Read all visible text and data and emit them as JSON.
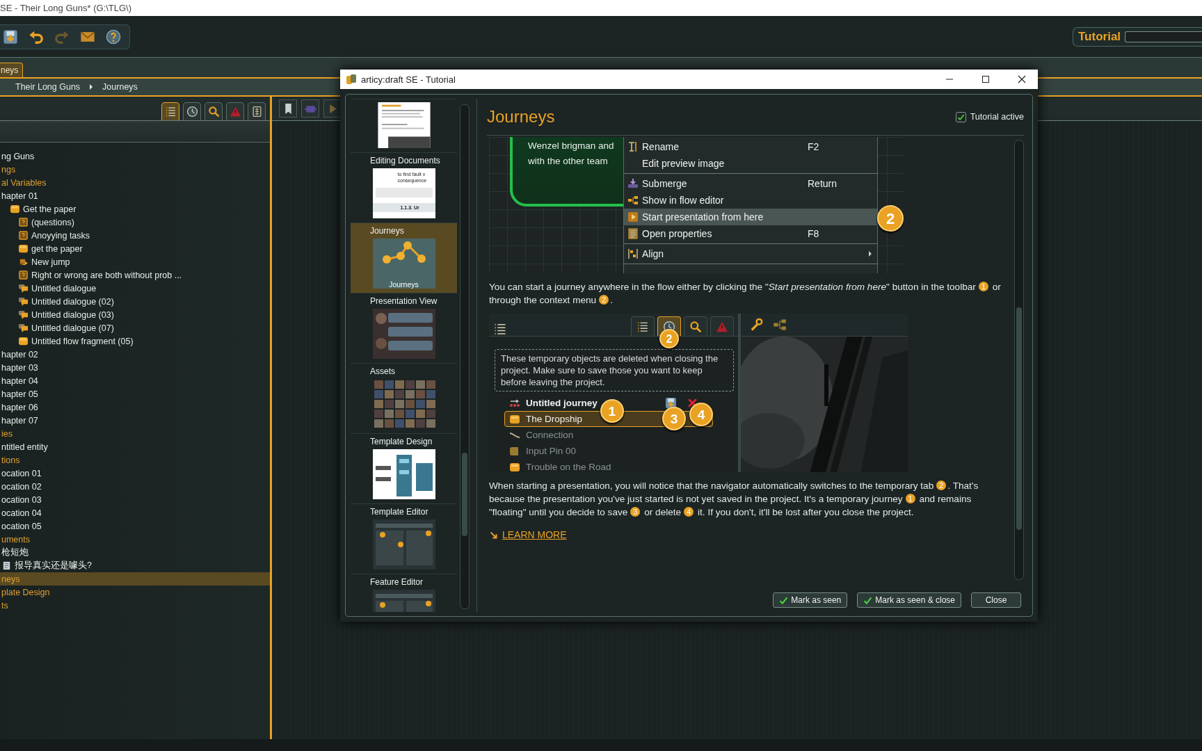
{
  "app": {
    "title": "SE - Their Long Guns* (G:\\TLG\\)",
    "toolbar": [
      {
        "kind": "save",
        "disabled": false
      },
      {
        "kind": "undo",
        "disabled": false
      },
      {
        "kind": "redo",
        "disabled": true
      },
      {
        "kind": "mail",
        "disabled": false
      },
      {
        "kind": "help",
        "disabled": false
      }
    ],
    "tutorial_label": "Tutorial"
  },
  "tabs": [
    {
      "label": "neys",
      "selected": true
    }
  ],
  "breadcrumb": [
    "Their Long Guns",
    "Journeys"
  ],
  "navigator": {
    "tools": [
      {
        "kind": "list",
        "selected": true
      },
      {
        "kind": "clock",
        "selected": false
      },
      {
        "kind": "search",
        "selected": false
      },
      {
        "kind": "warning",
        "selected": false
      },
      {
        "kind": "grid",
        "selected": false
      }
    ],
    "tree": [
      {
        "label": "ng Guns",
        "kind": "entry",
        "selected": false
      },
      {
        "label": "ngs",
        "kind": "folder",
        "selected": false
      },
      {
        "label": "al Variables",
        "kind": "folder",
        "selected": false
      },
      {
        "label": "hapter 01",
        "kind": "entry",
        "selected": false,
        "children": [
          {
            "label": "Get the paper",
            "kind": "fragment",
            "selected": false,
            "children": [
              {
                "label": "(questions)",
                "kind": "question",
                "selected": false
              },
              {
                "label": "Anoyying tasks",
                "kind": "question",
                "selected": false
              },
              {
                "label": "get the paper",
                "kind": "fragment",
                "selected": false
              },
              {
                "label": "New jump",
                "kind": "jump",
                "selected": false
              },
              {
                "label": "Right or wrong are both without prob ...",
                "kind": "question",
                "selected": false
              },
              {
                "label": "Untitled dialogue",
                "kind": "dialogue",
                "selected": false
              },
              {
                "label": "Untitled dialogue (02)",
                "kind": "dialogue",
                "selected": false
              },
              {
                "label": "Untitled dialogue (03)",
                "kind": "dialogue",
                "selected": false
              },
              {
                "label": "Untitled dialogue (07)",
                "kind": "dialogue",
                "selected": false
              },
              {
                "label": "Untitled flow fragment (05)",
                "kind": "fragment",
                "selected": false
              }
            ]
          }
        ]
      },
      {
        "label": "hapter 02",
        "kind": "entry",
        "selected": false
      },
      {
        "label": "hapter 03",
        "kind": "entry",
        "selected": false
      },
      {
        "label": "hapter 04",
        "kind": "entry",
        "selected": false
      },
      {
        "label": "hapter 05",
        "kind": "entry",
        "selected": false
      },
      {
        "label": "hapter 06",
        "kind": "entry",
        "selected": false
      },
      {
        "label": "hapter 07",
        "kind": "entry",
        "selected": false
      },
      {
        "label": "ies",
        "kind": "folder",
        "selected": false
      },
      {
        "label": "ntitled entity",
        "kind": "entry",
        "selected": false
      },
      {
        "label": "tions",
        "kind": "folder",
        "selected": false
      },
      {
        "label": "ocation 01",
        "kind": "entry",
        "selected": false
      },
      {
        "label": "ocation 02",
        "kind": "entry",
        "selected": false
      },
      {
        "label": "ocation 03",
        "kind": "entry",
        "selected": false
      },
      {
        "label": "ocation 04",
        "kind": "entry",
        "selected": false
      },
      {
        "label": "ocation 05",
        "kind": "entry",
        "selected": false
      },
      {
        "label": "uments",
        "kind": "folder",
        "selected": false
      },
      {
        "label": "枪短炮",
        "kind": "entry",
        "selected": false
      },
      {
        "label": "报导真实还是噱头?",
        "kind": "document",
        "selected": false
      },
      {
        "label": "neys",
        "kind": "folder",
        "selected": true
      },
      {
        "label": "plate Design",
        "kind": "folder",
        "selected": false
      },
      {
        "label": "ts",
        "kind": "folder",
        "selected": false
      }
    ]
  },
  "editor_tools": [
    {
      "kind": "page"
    },
    {
      "kind": "node"
    },
    {
      "kind": "play"
    }
  ],
  "dialog": {
    "title": "articy:draft SE - Tutorial",
    "topics": [
      {
        "kind": "document",
        "selected": false
      },
      {
        "label": "Editing Documents",
        "kind": "editor",
        "texts": [
          "to find fault v",
          "consequence",
          "1.1.3. Ur"
        ],
        "selected": false
      },
      {
        "label": "Journeys",
        "kind": "journeys",
        "caption": "Journeys",
        "selected": true
      },
      {
        "label": "Presentation View",
        "kind": "presentation",
        "selected": false
      },
      {
        "label": "Assets",
        "kind": "assets",
        "selected": false
      },
      {
        "label": "Template Design",
        "kind": "template",
        "selected": false
      },
      {
        "label": "Template Editor",
        "kind": "panels",
        "selected": false
      },
      {
        "label": "Feature Editor",
        "kind": "panels",
        "selected": false
      }
    ],
    "heading": "Journeys",
    "tutorial_active": {
      "label": "Tutorial active",
      "checked": true
    },
    "figure_1": {
      "node_text": [
        "Wenzel brigman and",
        "with the other team"
      ],
      "menu_groups": [
        {
          "items": [
            {
              "kind": "rename",
              "label": "Rename",
              "shortcut": "F2",
              "selected": false,
              "submenu": false
            },
            {
              "kind": "plain",
              "label": "Edit preview image",
              "selected": false,
              "submenu": false
            }
          ]
        },
        {
          "items": [
            {
              "kind": "submerge",
              "label": "Submerge",
              "shortcut": "Return",
              "selected": false,
              "submenu": false
            },
            {
              "kind": "flow",
              "label": "Show in flow editor",
              "selected": false,
              "submenu": false
            },
            {
              "kind": "present",
              "label": "Start presentation from here",
              "selected": true,
              "submenu": false,
              "callout": "2"
            },
            {
              "kind": "props",
              "label": "Open properties",
              "shortcut": "F8",
              "selected": false,
              "submenu": false
            }
          ]
        },
        {
          "items": [
            {
              "kind": "align",
              "label": "Align",
              "selected": false,
              "submenu": true
            }
          ]
        }
      ]
    },
    "paragraph_1": [
      {
        "text": "You can start a journey anywhere in the flow either by clicking the \"*Start presentation from here*\" button in the toolbar"
      },
      {
        "badge": "1"
      },
      {
        "text": " or through the context menu"
      },
      {
        "badge": "2"
      },
      {
        "text": "."
      }
    ],
    "figure_2": {
      "tools": [
        {
          "kind": "list",
          "selected": false
        },
        {
          "kind": "clock",
          "selected": true,
          "callout": "2"
        },
        {
          "kind": "search",
          "selected": false
        },
        {
          "kind": "warning",
          "selected": false
        }
      ],
      "side_tools": [
        {
          "kind": "wrench"
        },
        {
          "kind": "tree"
        }
      ],
      "tooltip": "These temporary objects are deleted when closing the project. Make sure to save those you want to keep before leaving the project.",
      "rows": [
        {
          "kind": "journey",
          "label": "Untitled journey",
          "selected": false,
          "callout": "1",
          "actions": [
            {
              "kind": "save",
              "callout": "3"
            },
            {
              "kind": "delete",
              "callout": "4"
            }
          ]
        },
        {
          "kind": "fragment",
          "label": "The Dropship",
          "selected": true
        },
        {
          "kind": "connection",
          "label": "Connection",
          "selected": false
        },
        {
          "kind": "pin",
          "label": "Input Pin 00",
          "selected": false
        },
        {
          "kind": "fragment",
          "label": "Trouble on the Road",
          "selected": false
        }
      ]
    },
    "paragraph_2": [
      {
        "text": "When starting a presentation, you will notice that the navigator automatically switches to the temporary tab"
      },
      {
        "badge": "2"
      },
      {
        "text": ". That's because the presentation you've just started is not yet saved in the project. It's a temporary journey"
      },
      {
        "badge": "1"
      },
      {
        "text": " and remains \"floating\" until you decide to save"
      },
      {
        "badge": "3"
      },
      {
        "text": " or delete"
      },
      {
        "badge": "4"
      },
      {
        "text": " it. If you don't, it'll be lost after you close the project."
      }
    ],
    "learn_more": "LEARN MORE",
    "buttons": [
      {
        "label": "Mark as seen",
        "kind": "check"
      },
      {
        "label": "Mark as seen & close",
        "kind": "check"
      },
      {
        "label": "Close",
        "kind": "plain"
      }
    ]
  }
}
